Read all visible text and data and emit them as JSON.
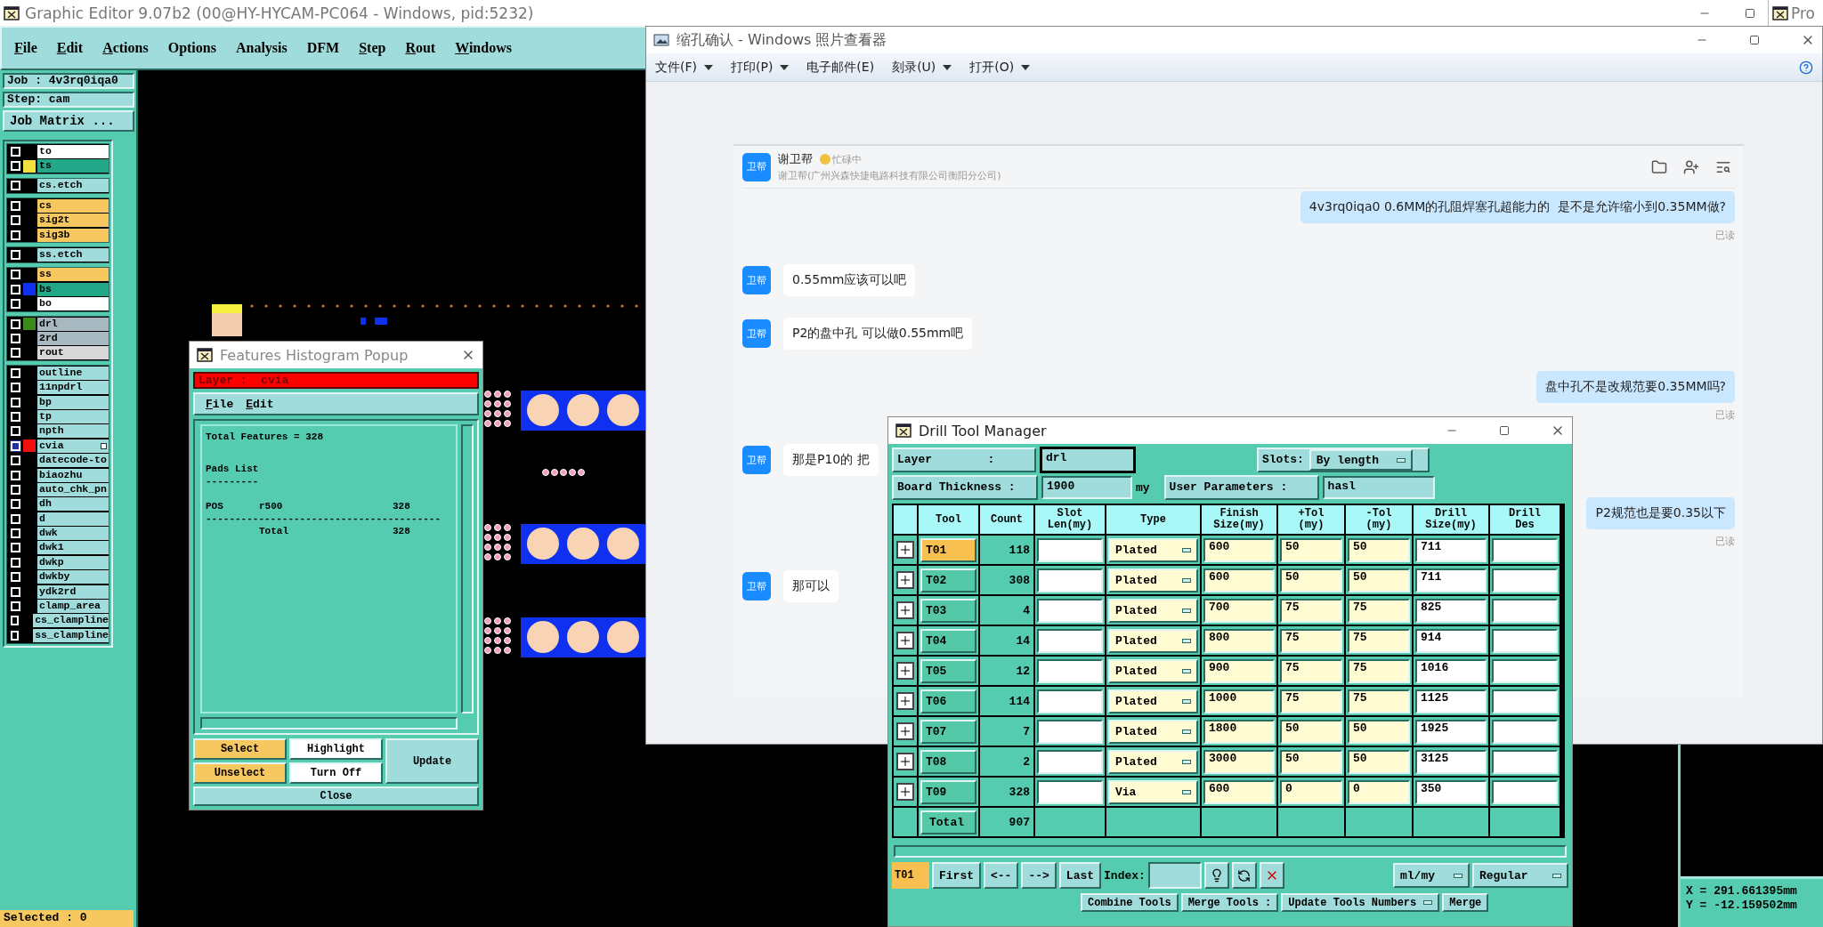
{
  "editor": {
    "title": "Graphic Editor 9.07b2 (00@HY-HYCAM-PC064 - Windows, pid:5232)",
    "other_window_title": "Pro",
    "menu": [
      {
        "label": "File",
        "mnemonic": true
      },
      {
        "label": "Edit",
        "mnemonic": true
      },
      {
        "label": "Actions",
        "mnemonic": true
      },
      {
        "label": "Options",
        "mnemonic": false
      },
      {
        "label": "Analysis",
        "mnemonic": false
      },
      {
        "label": "DFM",
        "mnemonic": false
      },
      {
        "label": "Step",
        "mnemonic": true
      },
      {
        "label": "Rout",
        "mnemonic": true
      },
      {
        "label": "Windows",
        "mnemonic": true
      }
    ],
    "job_label": "Job : 4v3rq0iqa0",
    "step_label": "Step: cam",
    "job_matrix_button": "Job Matrix ...",
    "layer_groups": [
      [
        {
          "name": "to",
          "color": "#ffffff",
          "affected": false
        },
        {
          "name": "ts",
          "color": "#22a888",
          "swatch": {
            "color": "#f0e040"
          },
          "affected": false
        }
      ],
      [
        {
          "name": "cs.etch",
          "color": "#a0dcdc",
          "affected": false
        }
      ],
      [
        {
          "name": "cs",
          "color": "#f8c860",
          "affected": false
        },
        {
          "name": "sig2t",
          "color": "#f8c860",
          "affected": false
        },
        {
          "name": "sig3b",
          "color": "#f8c860",
          "affected": false
        }
      ],
      [
        {
          "name": "ss.etch",
          "color": "#a0dcdc",
          "affected": false
        }
      ],
      [
        {
          "name": "ss",
          "color": "#f8c860",
          "affected": false
        },
        {
          "name": "bs",
          "color": "#22a888",
          "swatch": {
            "color": "#1030f0"
          },
          "affected": false
        },
        {
          "name": "bo",
          "color": "#ffffff",
          "affected": false
        }
      ],
      [
        {
          "name": "drl",
          "color": "#a8b8c0",
          "swatch": {
            "color": "#3a8a1a"
          },
          "affected": false
        },
        {
          "name": "2rd",
          "color": "#a8b8c0",
          "affected": false
        },
        {
          "name": "rout",
          "color": "#d8d8d8",
          "affected": false
        }
      ],
      [
        {
          "name": "outline",
          "color": "#a0dcdc",
          "affected": false
        },
        {
          "name": "11npdrl",
          "color": "#a0dcdc",
          "affected": false
        },
        {
          "name": "bp",
          "color": "#a0dcdc",
          "affected": false
        },
        {
          "name": "tp",
          "color": "#a0dcdc",
          "affected": false
        },
        {
          "name": "npth",
          "color": "#a0dcdc",
          "affected": false
        },
        {
          "name": "cvia",
          "color": "#a0dcdc",
          "swatch": {
            "color": "#f01010"
          },
          "affected": true
        },
        {
          "name": "datecode-to",
          "color": "#a0dcdc",
          "affected": false
        },
        {
          "name": "biaozhu",
          "color": "#a0dcdc",
          "affected": false
        },
        {
          "name": "auto_chk_pn",
          "color": "#a0dcdc",
          "affected": false
        },
        {
          "name": "dh",
          "color": "#a0dcdc",
          "affected": false
        },
        {
          "name": "d",
          "color": "#a0dcdc",
          "affected": false
        },
        {
          "name": "dwk",
          "color": "#a0dcdc",
          "affected": false
        },
        {
          "name": "dwk1",
          "color": "#a0dcdc",
          "affected": false
        },
        {
          "name": "dwkp",
          "color": "#a0dcdc",
          "affected": false
        },
        {
          "name": "dwkby",
          "color": "#a0dcdc",
          "affected": false
        },
        {
          "name": "ydk2rd",
          "color": "#a0dcdc",
          "affected": false
        },
        {
          "name": "clamp_area",
          "color": "#a0dcdc",
          "affected": false
        },
        {
          "name": "cs_clampline",
          "color": "#a0dcdc",
          "affected": false
        },
        {
          "name": "ss_clampline",
          "color": "#a0dcdc",
          "affected": false
        }
      ]
    ],
    "selected_status": "Selected : 0",
    "coordinates": {
      "x": "X = 291.661395mm",
      "y": "Y = -12.159502mm"
    }
  },
  "histogram_popup": {
    "title": "Features Histogram Popup",
    "layer": "Layer :  cvia",
    "menu": [
      "File",
      "Edit"
    ],
    "total_features": "Total Features = 328",
    "section_title": "Pads List",
    "section_rule": "---------",
    "rows": [
      {
        "type": "POS",
        "symbol": "r500",
        "count": "328"
      }
    ],
    "rule": "----------------------------------------",
    "total_label": "Total",
    "total_count": "328",
    "buttons": [
      {
        "label": "Select",
        "kind": "accent"
      },
      {
        "label": "Highlight",
        "kind": "toggle"
      },
      {
        "label": "Unselect",
        "kind": "accent"
      },
      {
        "label": "Turn Off",
        "kind": "toggle"
      }
    ],
    "update_button": "Update",
    "close_button": "Close"
  },
  "photo_viewer": {
    "title": "缩孔确认 - Windows 照片查看器",
    "menu": [
      {
        "label": "文件(F)",
        "dropdown": true
      },
      {
        "label": "打印(P)",
        "dropdown": true
      },
      {
        "label": "电子邮件(E)",
        "dropdown": false
      },
      {
        "label": "刻录(U)",
        "dropdown": true
      },
      {
        "label": "打开(O)",
        "dropdown": true
      }
    ],
    "chat": {
      "avatar": "卫帮",
      "name": "谢卫帮",
      "status": "忙碌中",
      "subtitle": "谢卫帮(广州兴森快捷电路科技有限公司衡阳分公司)",
      "messages": [
        {
          "kind": "outgoing",
          "text": "4v3rq0iqa0 0.6MM的孔阻焊塞孔超能力的  是不是允许缩小到0.35MM做?",
          "read": "已读"
        },
        {
          "kind": "incoming",
          "avatar": "卫帮",
          "text": "0.55mm应该可以吧"
        },
        {
          "kind": "incoming",
          "avatar": "卫帮",
          "text": "P2的盘中孔 可以做0.55mm吧"
        },
        {
          "kind": "outgoing",
          "text": "盘中孔不是改规范要0.35MM吗?",
          "read": "已读"
        },
        {
          "kind": "incoming",
          "avatar": "卫帮",
          "text": "那是P10的 把"
        },
        {
          "kind": "outgoing",
          "text": "P2规范也是要0.35以下",
          "read": "已读"
        },
        {
          "kind": "incoming",
          "avatar": "卫帮",
          "text": "那可以"
        }
      ]
    }
  },
  "drill_tool_manager": {
    "title": "Drill Tool Manager",
    "layer_label": "Layer        :",
    "layer_value": "drl",
    "slots_label": "Slots:",
    "slots_value": "By length",
    "thickness_label": "Board Thickness :",
    "thickness_value": "1900",
    "thickness_unit": "my",
    "user_params_button": "User Parameters :",
    "user_params_value": "hasl",
    "columns": [
      "Tool",
      "Count",
      "Slot\nLen(my)",
      "Type",
      "Finish\nSize(my)",
      "+Tol\n(my)",
      "-Tol\n(my)",
      "Drill\nSize(my)",
      "Drill\nDes"
    ],
    "rows": [
      {
        "tool": "T01",
        "count": "118",
        "type": "Plated",
        "finish": "600",
        "plus_tol": "50",
        "minus_tol": "50",
        "drill": "711",
        "selected": true
      },
      {
        "tool": "T02",
        "count": "308",
        "type": "Plated",
        "finish": "600",
        "plus_tol": "50",
        "minus_tol": "50",
        "drill": "711",
        "selected": false
      },
      {
        "tool": "T03",
        "count": "4",
        "type": "Plated",
        "finish": "700",
        "plus_tol": "75",
        "minus_tol": "75",
        "drill": "825",
        "selected": false
      },
      {
        "tool": "T04",
        "count": "14",
        "type": "Plated",
        "finish": "800",
        "plus_tol": "75",
        "minus_tol": "75",
        "drill": "914",
        "selected": false
      },
      {
        "tool": "T05",
        "count": "12",
        "type": "Plated",
        "finish": "900",
        "plus_tol": "75",
        "minus_tol": "75",
        "drill": "1016",
        "selected": false
      },
      {
        "tool": "T06",
        "count": "114",
        "type": "Plated",
        "finish": "1000",
        "plus_tol": "75",
        "minus_tol": "75",
        "drill": "1125",
        "selected": false
      },
      {
        "tool": "T07",
        "count": "7",
        "type": "Plated",
        "finish": "1800",
        "plus_tol": "50",
        "minus_tol": "50",
        "drill": "1925",
        "selected": false
      },
      {
        "tool": "T08",
        "count": "2",
        "type": "Plated",
        "finish": "3000",
        "plus_tol": "50",
        "minus_tol": "50",
        "drill": "3125",
        "selected": false
      },
      {
        "tool": "T09",
        "count": "328",
        "type": "Via",
        "finish": "600",
        "plus_tol": "0",
        "minus_tol": "0",
        "drill": "350",
        "selected": false
      }
    ],
    "total_label": "Total",
    "total_count": "907",
    "current_tool": "T01",
    "nav_buttons": [
      "First",
      "<--",
      "-->",
      "Last"
    ],
    "index_label": "Index:",
    "unit_value": "ml/my",
    "mode_value": "Regular",
    "combine_button": "Combine Tools",
    "merge_label": "Merge Tools :",
    "merge_value": "Update Tools Numbers",
    "merge_button": "Merge"
  }
}
